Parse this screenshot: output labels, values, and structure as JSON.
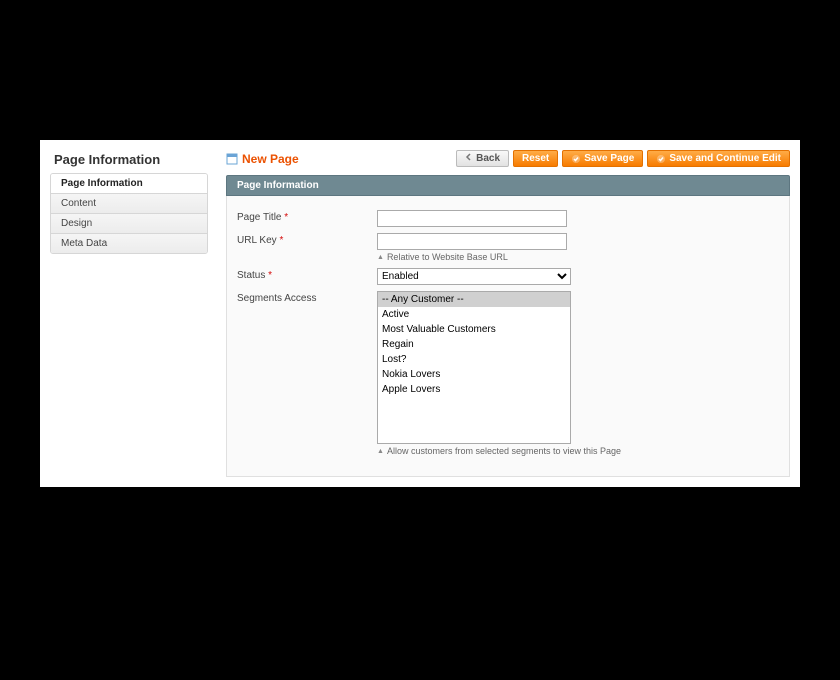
{
  "sidebar": {
    "title": "Page Information",
    "items": [
      {
        "label": "Page Information",
        "active": true
      },
      {
        "label": "Content",
        "active": false
      },
      {
        "label": "Design",
        "active": false
      },
      {
        "label": "Meta Data",
        "active": false
      }
    ]
  },
  "header": {
    "page_title": "New Page",
    "buttons": {
      "back": "Back",
      "reset": "Reset",
      "save": "Save Page",
      "save_continue": "Save and Continue Edit"
    }
  },
  "section": {
    "title": "Page Information"
  },
  "form": {
    "page_title": {
      "label": "Page Title",
      "value": ""
    },
    "url_key": {
      "label": "URL Key",
      "value": "",
      "hint": "Relative to Website Base URL"
    },
    "status": {
      "label": "Status",
      "value": "Enabled"
    },
    "segments": {
      "label": "Segments Access",
      "options": [
        "-- Any Customer --",
        "Active",
        "Most Valuable Customers",
        "Regain",
        "Lost?",
        "Nokia Lovers",
        "Apple Lovers"
      ],
      "selected": "-- Any Customer --",
      "hint": "Allow customers from selected segments to view this Page"
    }
  }
}
